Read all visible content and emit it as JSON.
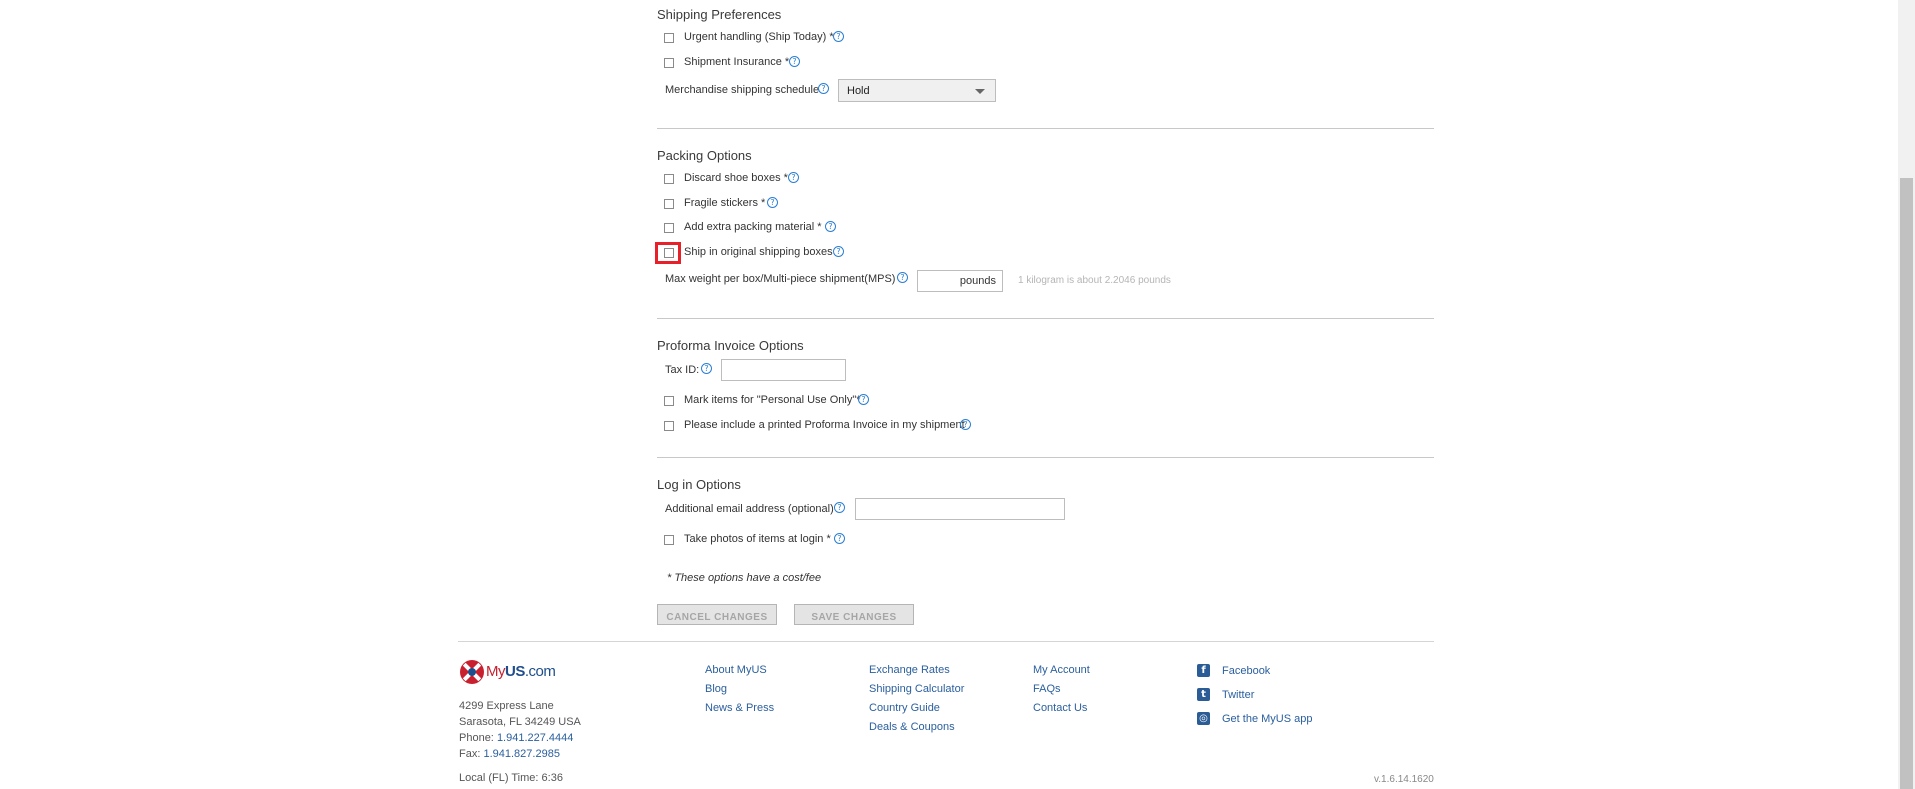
{
  "shipping": {
    "title": "Shipping Preferences",
    "urgent_label": "Urgent handling (Ship Today) *",
    "insurance_label": "Shipment Insurance *",
    "schedule_label": "Merchandise shipping schedule",
    "schedule_value": "Hold"
  },
  "packing": {
    "title": "Packing Options",
    "discard_label": "Discard shoe boxes *",
    "fragile_label": "Fragile stickers *",
    "extra_label": "Add extra packing material *",
    "original_label": "Ship in original shipping boxes",
    "maxweight_label": "Max weight per box/Multi-piece shipment(MPS)",
    "maxweight_unit": "pounds",
    "maxweight_hint": "1 kilogram is about 2.2046 pounds"
  },
  "proforma": {
    "title": "Proforma Invoice Options",
    "taxid_label": "Tax ID:",
    "personal_label": "Mark items for \"Personal Use Only\"*",
    "printed_label": "Please include a printed Proforma Invoice in my shipment"
  },
  "login": {
    "title": "Log in Options",
    "email_label": "Additional email address (optional)",
    "photos_label": "Take photos of items at login *"
  },
  "note": "* These options have a cost/fee",
  "buttons": {
    "cancel": "CANCEL CHANGES",
    "save": "SAVE CHANGES"
  },
  "footer": {
    "logo_prefix": "My",
    "logo_brand": "US",
    "logo_suffix": ".com",
    "address1": "4299 Express Lane",
    "address2": "Sarasota, FL 34249 USA",
    "phone_label": "Phone:",
    "phone": "1.941.227.4444",
    "fax_label": "Fax:",
    "fax": "1.941.827.2985",
    "local_time": "Local (FL) Time: 6:36",
    "col1": [
      "About MyUS",
      "Blog",
      "News & Press"
    ],
    "col2": [
      "Exchange Rates",
      "Shipping Calculator",
      "Country Guide",
      "Deals & Coupons"
    ],
    "col3": [
      "My Account",
      "FAQs",
      "Contact Us"
    ],
    "social": [
      "Facebook",
      "Twitter",
      "Get the MyUS app"
    ],
    "version": "v.1.6.14.1620"
  },
  "help_glyph": "?",
  "colors": {
    "link": "#2a5f9e",
    "help": "#2a7fd4",
    "highlight": "#e8202a",
    "brand_red": "#c8202f"
  }
}
